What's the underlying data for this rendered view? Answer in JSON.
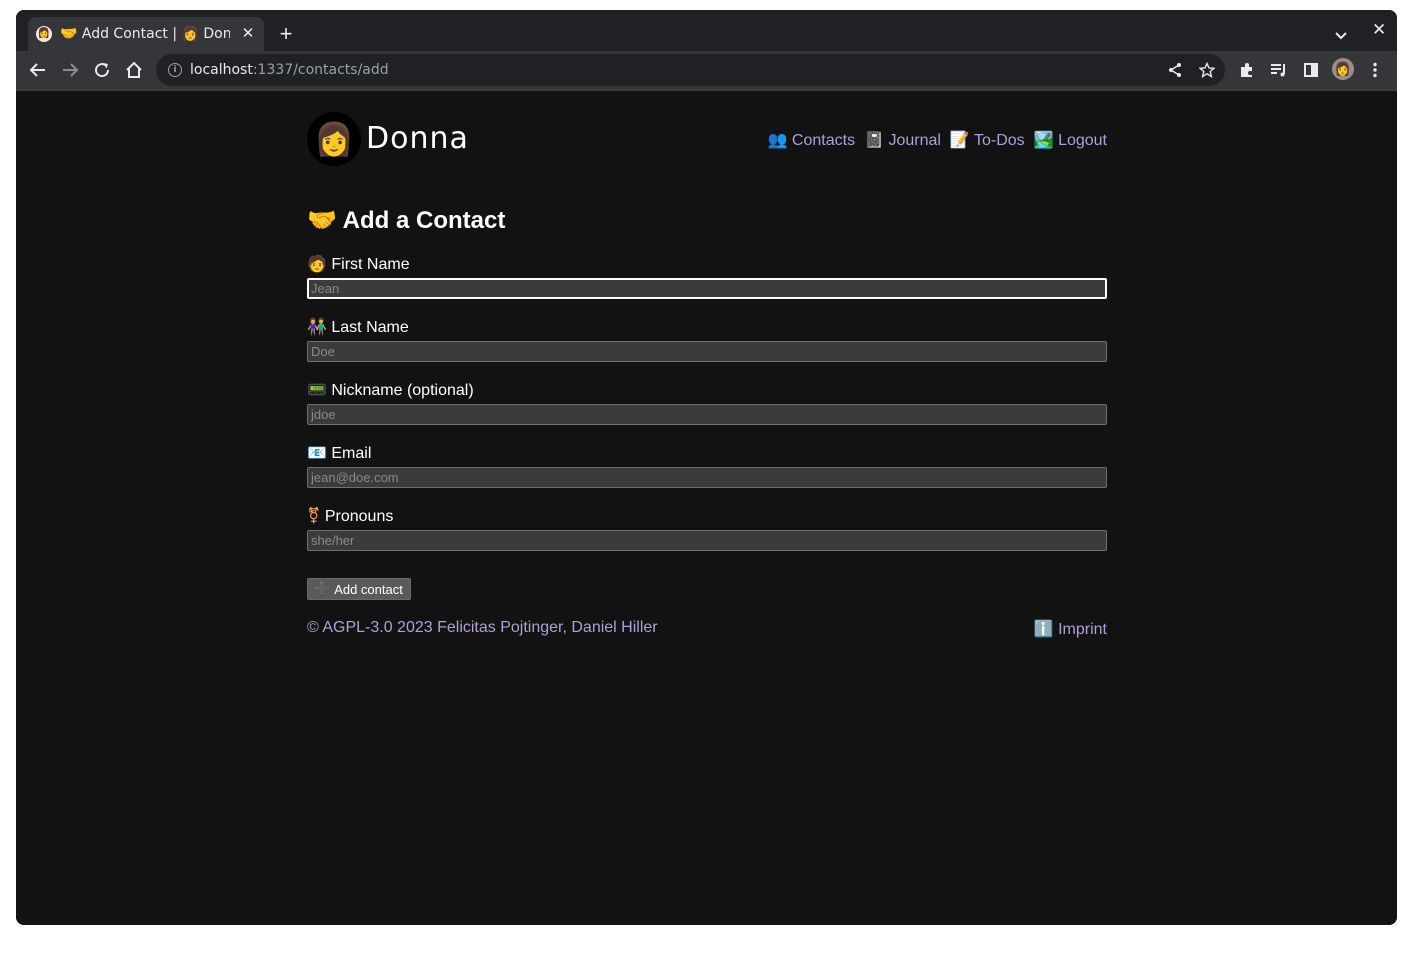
{
  "browser": {
    "tab": {
      "title": "🤝 Add Contact | 👩 Donna",
      "close_glyph": "✕"
    },
    "new_tab_glyph": "+",
    "window_close_glyph": "✕",
    "address": {
      "host": "localhost",
      "path": ":1337/contacts/add"
    }
  },
  "site": {
    "brand": "Donna",
    "logo_glyph": "👩",
    "nav": [
      {
        "icon": "👥",
        "label": "Contacts"
      },
      {
        "icon": "📓",
        "label": "Journal"
      },
      {
        "icon": "📝",
        "label": "To-Dos"
      },
      {
        "icon": "🏞️",
        "label": "Logout"
      }
    ]
  },
  "form": {
    "title_icon": "🤝",
    "title": "Add a Contact",
    "fields": [
      {
        "icon": "🧑",
        "label": "First Name",
        "placeholder": "Jean",
        "value": ""
      },
      {
        "icon": "👫",
        "label": "Last Name",
        "placeholder": "Doe",
        "value": ""
      },
      {
        "icon": "📟",
        "label": "Nickname (optional)",
        "placeholder": "jdoe",
        "value": ""
      },
      {
        "icon": "📧",
        "label": "Email",
        "placeholder": "jean@doe.com",
        "value": ""
      },
      {
        "icon": "⚧",
        "label": "Pronouns",
        "placeholder": "she/her",
        "value": ""
      }
    ],
    "submit_icon": "➕",
    "submit_label": "Add contact"
  },
  "footer": {
    "copyright": "© AGPL-3.0 2023 Felicitas Pojtinger, Daniel Hiller",
    "imprint_icon": "ℹ️",
    "imprint_label": "Imprint"
  },
  "colors": {
    "page_bg": "#121212",
    "link": "#b39ddb",
    "input_bg": "#3b3b3b",
    "button_bg": "#5a5a5a"
  }
}
